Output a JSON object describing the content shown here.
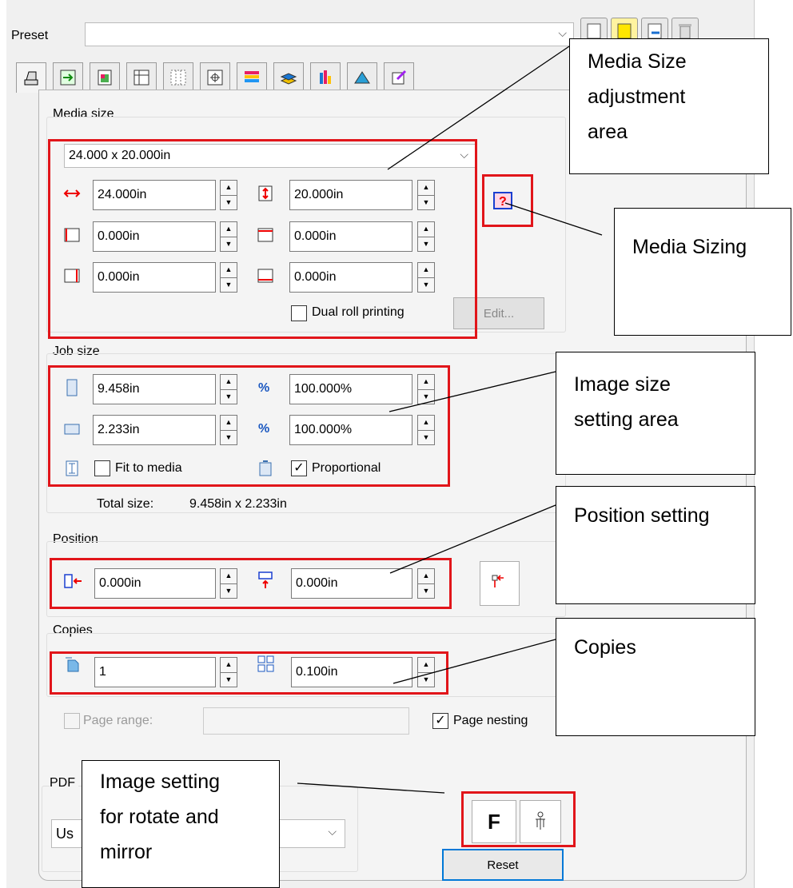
{
  "preset": {
    "label": "Preset",
    "value": ""
  },
  "media_size": {
    "title": "Media size",
    "dropdown": "24.000 x 20.000in",
    "width": "24.000in",
    "height": "20.000in",
    "margin_left": "0.000in",
    "margin_top": "0.000in",
    "margin_right": "0.000in",
    "margin_bottom": "0.000in",
    "dual_roll_label": "Dual roll printing",
    "edit_label": "Edit..."
  },
  "job_size": {
    "title": "Job size",
    "height": "9.458in",
    "height_pct_sym": "%",
    "height_pct": "100.000%",
    "width": "2.233in",
    "width_pct_sym": "%",
    "width_pct": "100.000%",
    "fit_label": "Fit to media",
    "proportional_label": "Proportional",
    "total_label": "Total size:",
    "total_value": "9.458in x 2.233in"
  },
  "position": {
    "title": "Position",
    "x": "0.000in",
    "y": "0.000in"
  },
  "copies": {
    "title": "Copies",
    "count": "1",
    "gap": "0.100in"
  },
  "page_range_label": "Page range:",
  "page_nesting_label": "Page nesting",
  "pdf": {
    "title": "PDF",
    "select_value": "Us"
  },
  "orientation_button": "F",
  "reset_label": "Reset",
  "callouts": {
    "media_adjust": [
      "Media Size",
      "adjustment",
      "area"
    ],
    "media_sizing": "Media Sizing",
    "image_size": [
      "Image size",
      "setting area"
    ],
    "position": "Position setting",
    "copies": "Copies",
    "image_setting": [
      "Image setting",
      "for rotate and",
      "mirror"
    ]
  }
}
